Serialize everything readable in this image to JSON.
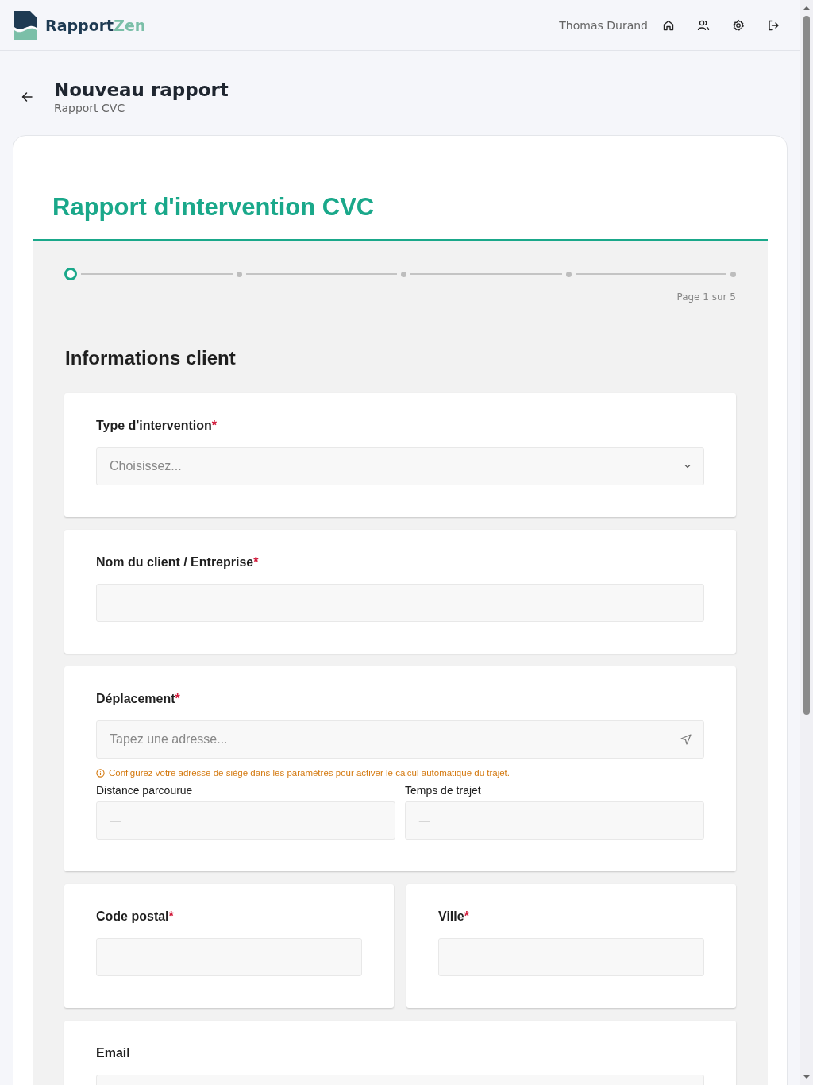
{
  "header": {
    "brand_primary": "Rapport",
    "brand_accent": "Zen",
    "user_name": "Thomas Durand"
  },
  "page": {
    "title": "Nouveau rapport",
    "subtitle": "Rapport CVC"
  },
  "form": {
    "title": "Rapport d'intervention CVC",
    "steps": [
      {
        "selected": true
      },
      {
        "selected": false
      },
      {
        "selected": false
      },
      {
        "selected": false
      },
      {
        "selected": false
      }
    ],
    "page_label": "Page 1 sur 5",
    "section_title": "Informations client",
    "fields": [
      {
        "kind": "select",
        "label": "Type d'intervention",
        "required_mark": "*",
        "placeholder": "Choisissez..."
      },
      {
        "kind": "text",
        "label": "Nom du client / Entreprise",
        "required_mark": "*"
      },
      {
        "kind": "address",
        "label": "Déplacement",
        "required_mark": "*",
        "placeholder": "Tapez une adresse...",
        "hint": "Configurez votre adresse de siège dans les paramètres pour activer le calcul automatique du trajet.",
        "subfields": [
          {
            "label": "Distance parcourue",
            "value": "—"
          },
          {
            "label": "Temps de trajet",
            "value": "—"
          }
        ]
      },
      {
        "kind": "half",
        "label": "Code postal",
        "required_mark": "*"
      },
      {
        "kind": "half",
        "label": "Ville",
        "required_mark": "*"
      },
      {
        "kind": "text",
        "label": "Email"
      }
    ]
  }
}
